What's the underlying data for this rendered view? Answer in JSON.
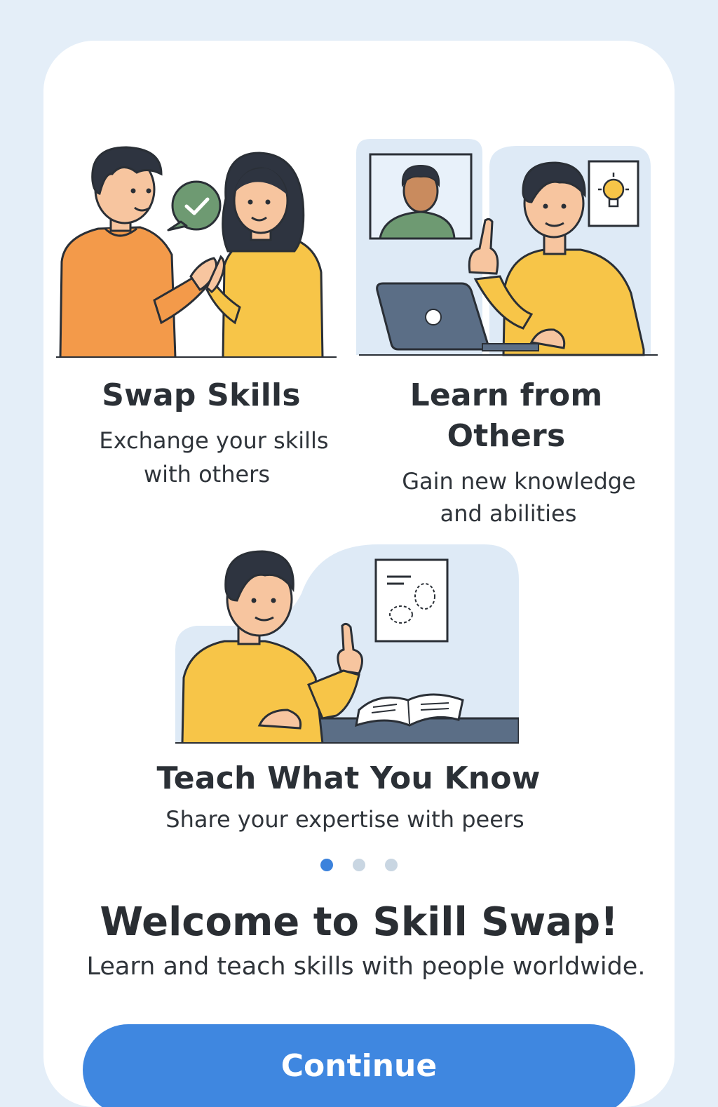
{
  "features": [
    {
      "title": "Swap Skills",
      "description_lines": [
        "Exchange your skills",
        "with others"
      ]
    },
    {
      "title_lines": [
        "Learn from",
        "Others"
      ],
      "description_lines": [
        "Gain new knowledge",
        "and abilities"
      ]
    },
    {
      "title": "Teach What You Know",
      "description_lines": [
        "Share your expertise with peers"
      ]
    }
  ],
  "pagination": {
    "total": 3,
    "active_index": 0
  },
  "welcome": {
    "heading": "Welcome to Skill Swap!",
    "subtitle": "Learn and teach skills with people worldwide."
  },
  "continue_label": "Continue",
  "colors": {
    "background": "#e4eef8",
    "card": "#ffffff",
    "accent": "#3f87e0",
    "dot_active": "#3b82dc",
    "dot_inactive": "#c9d6e2",
    "shirt_orange": "#f39a4a",
    "shirt_yellow": "#f7c548",
    "check_bubble": "#6e9a72",
    "laptop": "#5b6e86"
  },
  "icons": [
    "checkmark-bubble-icon",
    "lightbulb-icon",
    "open-book-icon",
    "laptop-icon"
  ]
}
